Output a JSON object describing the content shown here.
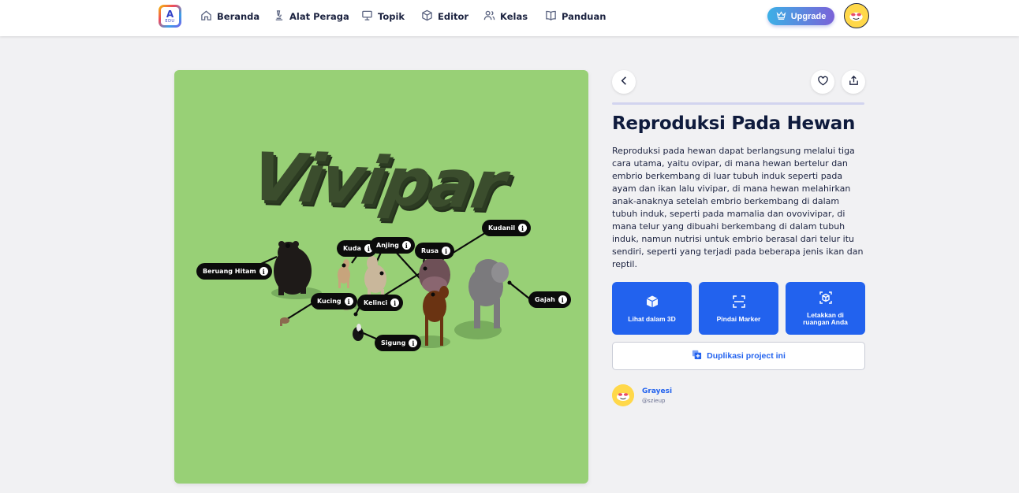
{
  "nav": {
    "logo_letter": "A",
    "logo_sub": "EDU",
    "items": [
      {
        "label": "Beranda",
        "icon": "home-icon"
      },
      {
        "label": "Alat Peraga",
        "icon": "microscope-icon"
      },
      {
        "label": "Topik",
        "icon": "presentation-icon"
      },
      {
        "label": "Editor",
        "icon": "cube-icon"
      },
      {
        "label": "Kelas",
        "icon": "users-icon"
      },
      {
        "label": "Panduan",
        "icon": "book-icon"
      }
    ],
    "upgrade_label": "Upgrade",
    "accent_gradient": [
      "#3cb0e6",
      "#7a62d8"
    ]
  },
  "scene": {
    "background": "#98d076",
    "title": "Vivipar",
    "labels": [
      {
        "name": "Beruang Hitam"
      },
      {
        "name": "Kuda"
      },
      {
        "name": "Anjing"
      },
      {
        "name": "Rusa"
      },
      {
        "name": "Kudanil"
      },
      {
        "name": "Kucing"
      },
      {
        "name": "Kelinci"
      },
      {
        "name": "Gajah"
      },
      {
        "name": "Sigung"
      }
    ],
    "info_glyph": "i"
  },
  "detail": {
    "title": "Reproduksi Pada Hewan",
    "description": "Reproduksi pada hewan dapat berlangsung melalui tiga cara utama, yaitu ovipar, di mana hewan bertelur dan embrio berkembang di luar tubuh induk seperti pada ayam dan ikan lalu vivipar, di mana hewan melahirkan anak-anaknya setelah embrio berkembang di dalam tubuh induk, seperti pada mamalia dan ovovivipar, di mana telur yang dibuahi berkembang di dalam tubuh induk, namun nutrisi untuk embrio berasal dari telur itu sendiri, seperti yang terjadi pada beberapa jenis ikan dan reptil.",
    "actions": [
      {
        "label": "Lihat dalam 3D",
        "icon": "cube-icon"
      },
      {
        "label": "Pindai Marker",
        "icon": "scan-icon"
      },
      {
        "label": "Letakkan di ruangan Anda",
        "icon": "ar-cube-icon"
      }
    ],
    "duplicate_label": "Duplikasi project ini",
    "primary_color": "#2262ee"
  },
  "author": {
    "name": "Grayesi",
    "handle": "@szieup"
  }
}
